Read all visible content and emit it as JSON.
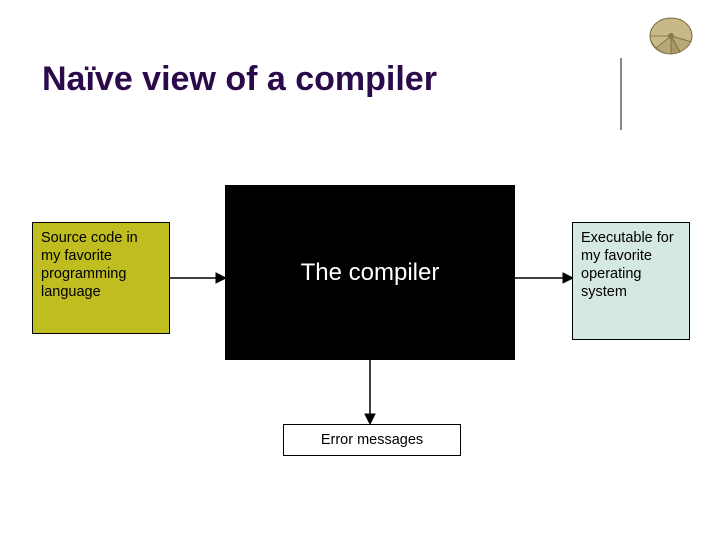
{
  "title": "Naïve view of a compiler",
  "boxes": {
    "source": "Source code in my favorite programming language",
    "compiler": "The compiler",
    "output": "Executable for my favorite operating system",
    "errors": "Error messages"
  },
  "colors": {
    "title": "#2a0a4a",
    "source_bg": "#bfbd1f",
    "compiler_bg": "#000000",
    "output_bg": "#d5e8e1",
    "errors_bg": "#ffffff"
  }
}
